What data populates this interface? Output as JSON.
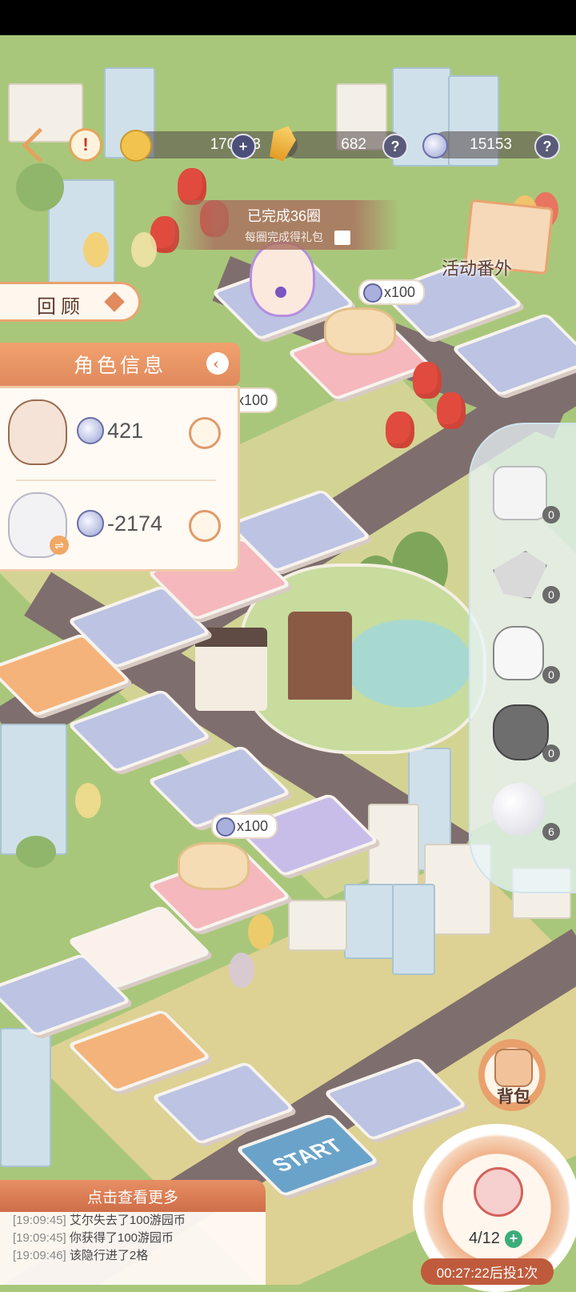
{
  "currencies": {
    "gold": "170713",
    "gem": "682",
    "token": "15153"
  },
  "progress": {
    "laps": "已完成36圈",
    "sub": "每圈完成得礼包"
  },
  "review_label": "回顾",
  "activity_label": "活动番外",
  "panel": {
    "title": "角色信息",
    "roles": [
      {
        "value": "421"
      },
      {
        "value": "-2174"
      }
    ]
  },
  "tile_rewards": [
    "x100",
    "x100",
    "x100",
    "x100"
  ],
  "start_label": "START",
  "items": [
    {
      "name": "dice",
      "count": "0"
    },
    {
      "name": "bent-arrow",
      "count": "0"
    },
    {
      "name": "glove-pinch",
      "count": "0"
    },
    {
      "name": "sack",
      "count": "0"
    },
    {
      "name": "snowball",
      "count": "6"
    }
  ],
  "backpack_label": "背包",
  "log": {
    "title": "点击查看更多",
    "lines": [
      {
        "time": "[19:09:45]",
        "text": "艾尔失去了100游园币"
      },
      {
        "time": "[19:09:45]",
        "text": "你获得了100游园币"
      },
      {
        "time": "[19:09:46]",
        "text": "该隐行进了2格"
      }
    ]
  },
  "dice": {
    "counter": "4/12",
    "timer": "00:27:22后投1次"
  },
  "colors": {
    "accent": "#e08a5d",
    "grass": "#a9c77a",
    "road": "#7f6e6e"
  }
}
